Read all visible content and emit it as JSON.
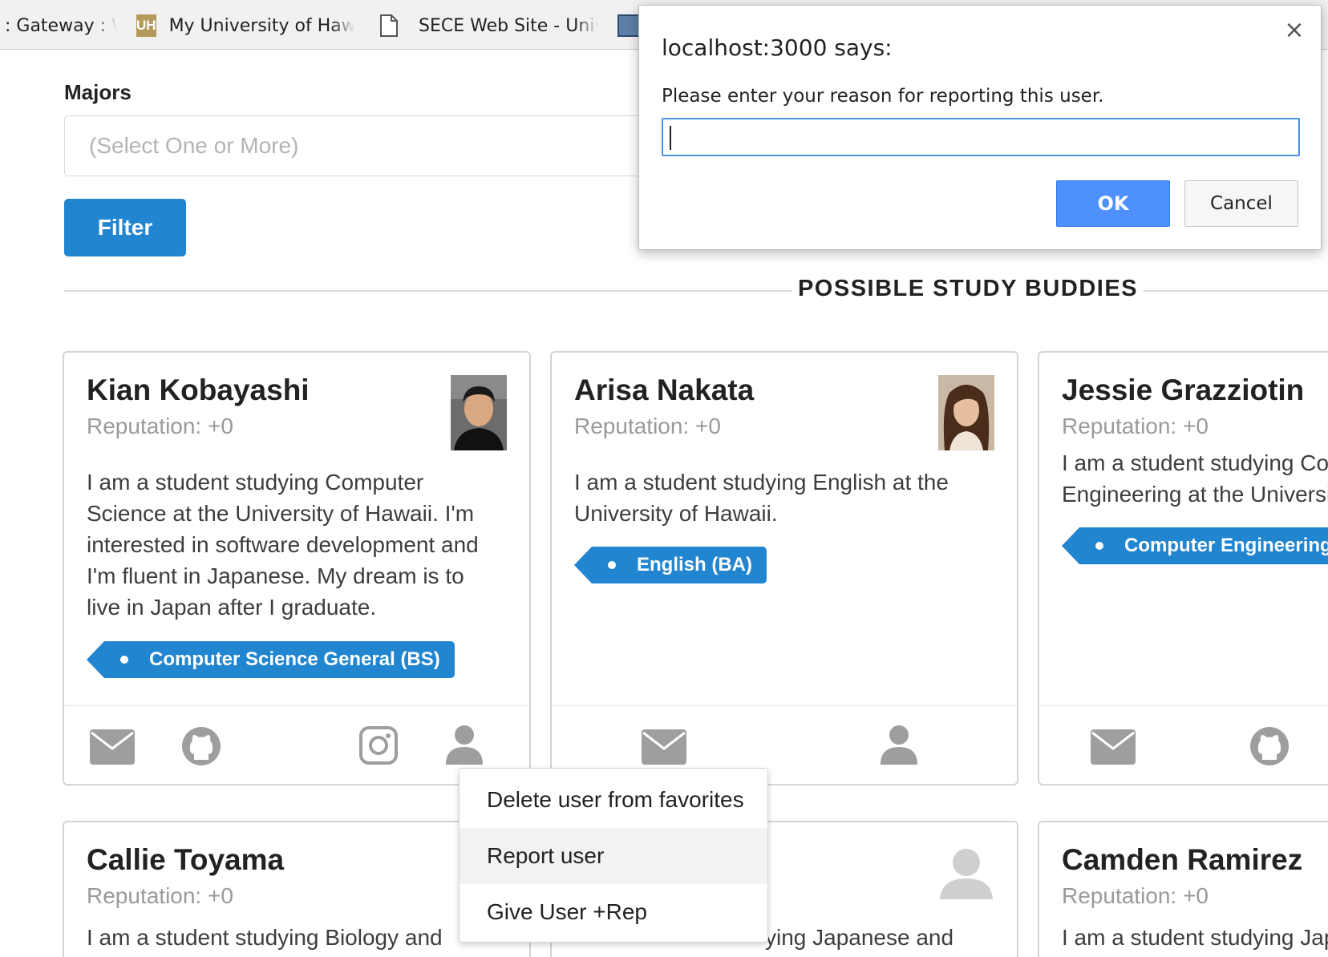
{
  "bookmarks": [
    {
      "label": ": Gateway : W",
      "icon": "none"
    },
    {
      "label": "My University of Haw",
      "icon": "uh-logo-icon",
      "icon_text": "UH"
    },
    {
      "label": "SECE Web Site - Unive",
      "icon": "document-icon"
    }
  ],
  "filter": {
    "majors_label": "Majors",
    "majors_placeholder": "(Select One or More)",
    "filter_button": "Filter"
  },
  "section_title": "POSSIBLE STUDY BUDDIES",
  "cards": [
    {
      "name": "Kian Kobayashi",
      "reputation": "Reputation: +0",
      "description": "I am a student studying Computer Science at the University of Hawaii. I'm interested in software development and I'm fluent in Japanese. My dream is to live in Japan after I graduate.",
      "tag": "Computer Science General (BS)",
      "icons": [
        "envelope-icon",
        "github-icon",
        "instagram-icon",
        "user-icon"
      ]
    },
    {
      "name": "Arisa Nakata",
      "reputation": "Reputation: +0",
      "description": "I am a student studying English at the University of Hawaii.",
      "tag": "English (BA)",
      "icons": [
        "envelope-icon",
        "user-icon"
      ]
    },
    {
      "name": "Jessie Grazziotin",
      "reputation": "Reputation: +0",
      "description": "I am a student studying Con Engineering at the Universi",
      "tag": "Computer Engineering (BS)",
      "icons": [
        "envelope-icon",
        "github-icon"
      ]
    },
    {
      "name": "Callie Toyama",
      "reputation": "Reputation: +0",
      "description": "I am a student studying Biology and"
    },
    {
      "description": "ying Japanese and"
    },
    {
      "name": "Camden Ramirez",
      "reputation": "Reputation: +0",
      "description": "I am a student studying Japa"
    }
  ],
  "context_menu": {
    "items": [
      "Delete user from favorites",
      "Report user",
      "Give User +Rep"
    ],
    "highlighted": "Report user"
  },
  "dialog": {
    "title": "localhost:3000 says:",
    "message": "Please enter your reason for reporting this user.",
    "input_value": "",
    "ok_label": "OK",
    "cancel_label": "Cancel",
    "close_symbol": "×"
  },
  "colors": {
    "primary": "#2185d0",
    "dialog_ok": "#4d90fe",
    "muted_text": "#9a9a9a",
    "icon_gray": "#9e9e9e"
  }
}
